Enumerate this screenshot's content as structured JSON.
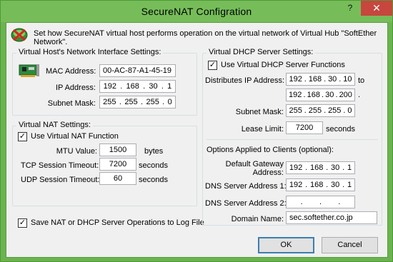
{
  "window": {
    "title": "SecureNAT Configration",
    "help_label": "?",
    "close_label": "✕"
  },
  "header": {
    "description": "Set how SecureNAT virtual host performs operation on the virtual network of Virtual Hub \"SoftEther Network\"."
  },
  "host": {
    "title": "Virtual Host's Network Interface Settings:",
    "mac_label": "MAC Address:",
    "mac_value": "00-AC-87-A1-45-19",
    "ip_label": "IP Address:",
    "ip_value": [
      "192",
      "168",
      "30",
      "1"
    ],
    "mask_label": "Subnet Mask:",
    "mask_value": [
      "255",
      "255",
      "255",
      "0"
    ]
  },
  "nat": {
    "title": "Virtual NAT Settings:",
    "use_label": "Use Virtual NAT Function",
    "use_checked": true,
    "mtu_label": "MTU Value:",
    "mtu_value": "1500",
    "mtu_unit": "bytes",
    "tcp_label": "TCP Session Timeout:",
    "tcp_value": "7200",
    "tcp_unit": "seconds",
    "udp_label": "UDP Session Timeout:",
    "udp_value": "60",
    "udp_unit": "seconds"
  },
  "log": {
    "label": "Save NAT or DHCP Server Operations to Log File",
    "checked": true
  },
  "dhcp": {
    "title": "Virtual DHCP Server Settings:",
    "use_label": "Use Virtual DHCP Server Functions",
    "use_checked": true,
    "range_label": "Distributes IP Address:",
    "range_start": [
      "192",
      "168",
      "30",
      "10"
    ],
    "to_label": "to",
    "range_end": [
      "192",
      "168",
      "30",
      "200"
    ],
    "end_dot": ".",
    "mask_label": "Subnet Mask:",
    "mask_value": [
      "255",
      "255",
      "255",
      "0"
    ],
    "lease_label": "Lease Limit:",
    "lease_value": "7200",
    "lease_unit": "seconds",
    "options_title": "Options Applied to Clients (optional):",
    "gateway_label_1": "Default Gateway",
    "gateway_label_2": "Address:",
    "gateway_value": [
      "192",
      "168",
      "30",
      "1"
    ],
    "dns1_label": "DNS Server Address 1:",
    "dns1_value": [
      "192",
      "168",
      "30",
      "1"
    ],
    "dns2_label": "DNS Server Address 2:",
    "dns2_value": [
      "",
      "",
      "",
      ""
    ],
    "domain_label": "Domain Name:",
    "domain_value": "sec.softether.co.jp"
  },
  "buttons": {
    "ok_label": "OK",
    "cancel_label": "Cancel"
  },
  "colors": {
    "frame": "#76bd5a",
    "close": "#c7463e",
    "client": "#f0f0f0"
  }
}
